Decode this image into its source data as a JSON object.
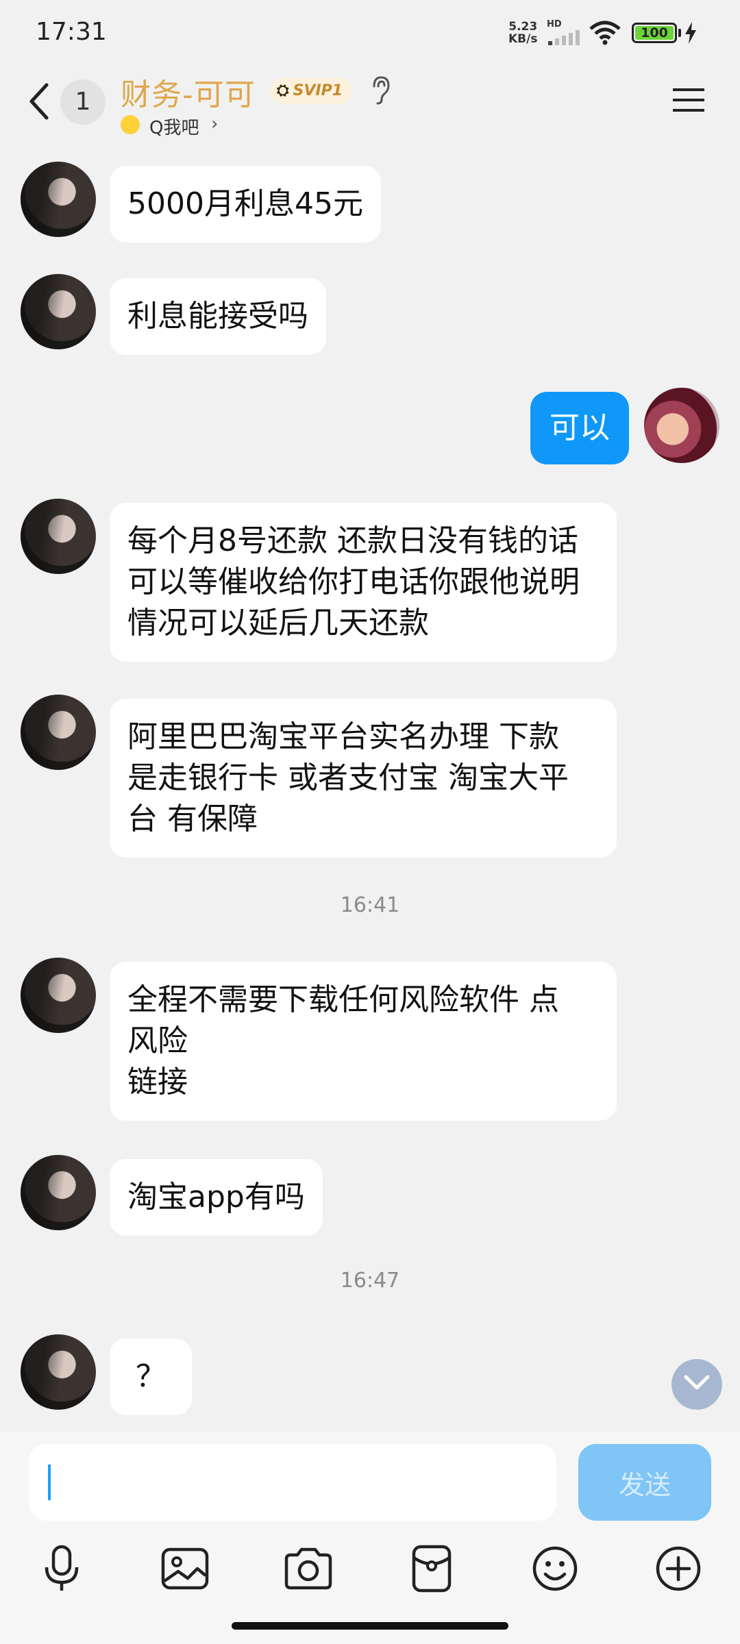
{
  "status_bar": {
    "time": "17:31",
    "net_speed_value": "5.23",
    "net_speed_unit": "KB/s",
    "hd": "HD",
    "battery": "100"
  },
  "header": {
    "unread_count": "1",
    "contact_name": "财务-可可",
    "vip_label": "SVIP1",
    "sub_label": "Q我吧",
    "name_color": "#e0a64a"
  },
  "messages": [
    {
      "side": "left",
      "text": "5000月利息45元"
    },
    {
      "side": "left",
      "text": "利息能接受吗"
    },
    {
      "side": "right",
      "text": "可以"
    },
    {
      "side": "left",
      "text": "每个月8号还款 还款日没有钱的话\n可以等催收给你打电话你跟他说明\n情况可以延后几天还款"
    },
    {
      "side": "left",
      "text": "阿里巴巴淘宝平台实名办理 下款\n是走银行卡 或者支付宝 淘宝大平\n台 有保障"
    },
    {
      "time": "16:41"
    },
    {
      "side": "left",
      "text": "全程不需要下载任何风险软件 点\n风险\n链接"
    },
    {
      "side": "left",
      "text": "淘宝app有吗"
    },
    {
      "time": "16:47"
    },
    {
      "side": "left",
      "text": "？"
    }
  ],
  "composer": {
    "input_value": "",
    "send_label": "发送"
  },
  "toolbar": [
    "mic-icon",
    "image-icon",
    "camera-icon",
    "red-packet-icon",
    "emoji-icon",
    "plus-icon"
  ],
  "colors": {
    "bubble_me": "#0f98f8",
    "send_button": "#7fc5f6",
    "background": "#f1f1f1"
  }
}
